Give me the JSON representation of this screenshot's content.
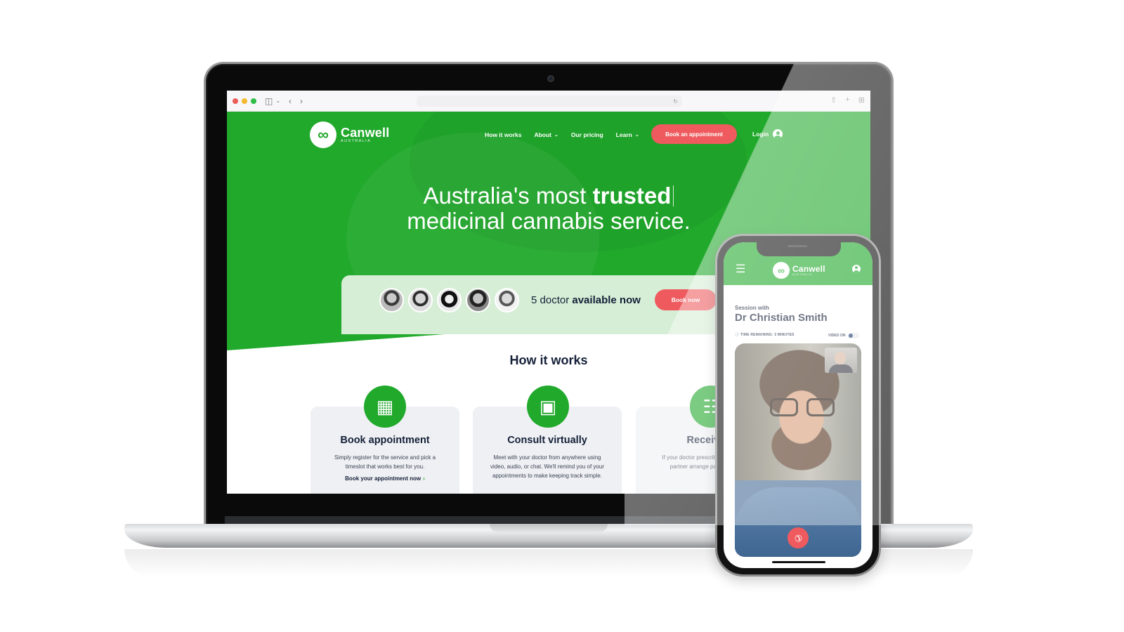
{
  "browser": {
    "traffic_lights": [
      "close",
      "minimize",
      "maximize"
    ],
    "icons": {
      "sidebar": "sidebar-icon",
      "back": "‹",
      "forward": "›",
      "reload": "↻",
      "share": "⇪",
      "new_tab": "+",
      "tab_overview": "⊞"
    }
  },
  "site": {
    "brand": {
      "name": "Canwell",
      "sub": "AUSTRALIA",
      "mark": "∞"
    },
    "nav": {
      "items": [
        {
          "label": "How it works",
          "has_dropdown": false
        },
        {
          "label": "About",
          "has_dropdown": true
        },
        {
          "label": "Our pricing",
          "has_dropdown": false
        },
        {
          "label": "Learn",
          "has_dropdown": true
        }
      ],
      "chevron": "⌄",
      "cta": "Book an appointment",
      "login": "Login"
    },
    "hero": {
      "line1_prefix": "Australia's most ",
      "line1_bold": "trusted",
      "line2": "medicinal cannabis service."
    },
    "availability": {
      "count_text": "5 doctor ",
      "bold_text": "available now",
      "doctors_shown": 5,
      "cta": "Book now"
    },
    "how_it_works": {
      "title": "How it works",
      "steps": [
        {
          "icon": "calendar-icon",
          "glyph": "▦",
          "title": "Book appointment",
          "description": "Simply register for the service and pick a timeslot that works best for you.",
          "link": "Book your appointment now",
          "link_arrow": "›"
        },
        {
          "icon": "video-devices-icon",
          "glyph": "▣",
          "title": "Consult virtually",
          "description": "Meet with your doctor from anywhere using video, audio, or chat. We'll remind you of your appointments to make keeping track simple."
        },
        {
          "icon": "delivery-trolley-icon",
          "glyph": "☷",
          "title": "Receive c",
          "description": "If your doctor prescribes our pharmacy partner arrange payment and qu"
        }
      ]
    },
    "colors": {
      "brand_green": "#21a92c",
      "cta_red": "#ee5a5e",
      "navy_text": "#152038",
      "card_bg": "#eef0f3",
      "availability_bg": "#d6eed6"
    }
  },
  "phone": {
    "menu_icon": "☰",
    "brand": {
      "name": "Canwell",
      "sub": "AUSTRALIA",
      "mark": "∞"
    },
    "session": {
      "label": "Session with",
      "doctor": "Dr Christian Smith",
      "time_remaining": "🕓 TIME REMAINING: 3 MINUTES",
      "video_label": "VIDEO ON",
      "video_on": true
    },
    "end_call_icon": "✆"
  }
}
